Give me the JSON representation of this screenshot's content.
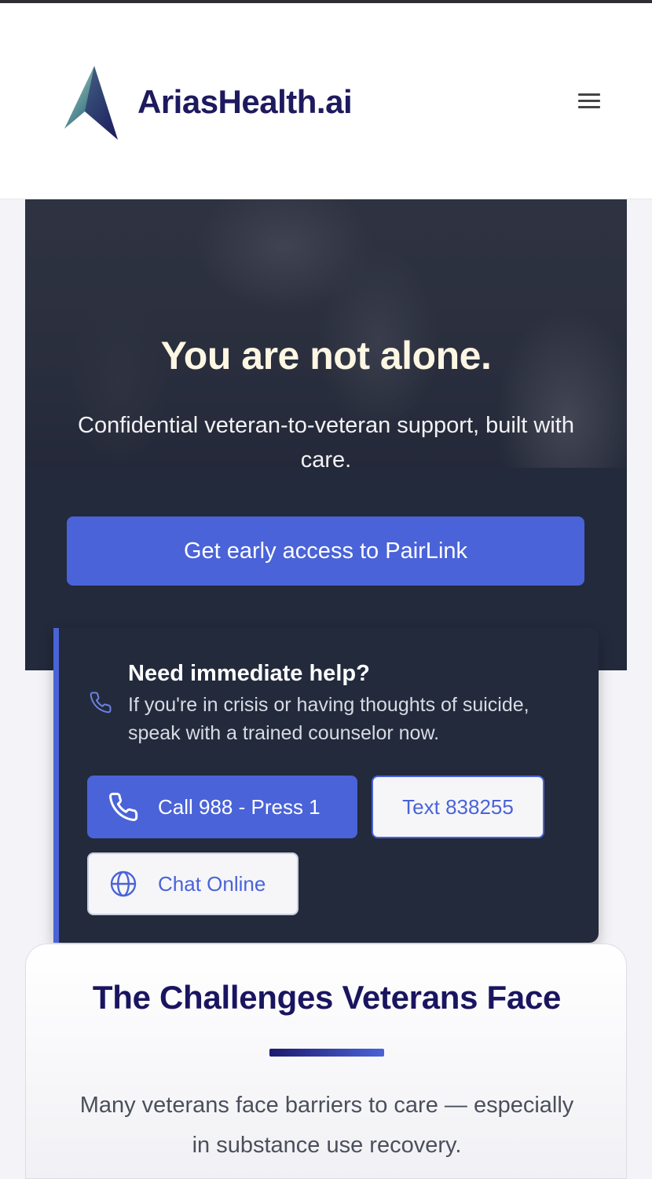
{
  "header": {
    "brand": "AriasHealth.ai",
    "logo_icon": "arias-arrow-logo",
    "menu_icon": "hamburger-menu-icon"
  },
  "hero": {
    "title": "You are not alone.",
    "subtitle": "Confidential veteran-to-veteran support, built with care.",
    "cta_label": "Get early access to PairLink"
  },
  "crisis": {
    "icon": "phone-icon",
    "title": "Need immediate help?",
    "text": "If you're in crisis or having thoughts of suicide, speak with a trained counselor now.",
    "call_label": "Call 988 - Press 1",
    "text_label": "Text 838255",
    "chat_label": "Chat Online",
    "chat_icon": "globe-icon"
  },
  "challenges": {
    "title": "The Challenges Veterans Face",
    "text": "Many veterans face barriers to care — especially in substance use recovery."
  },
  "colors": {
    "accent": "#4a63d8",
    "brand_navy": "#1e1a5e",
    "hero_bg": "#222a3c"
  }
}
